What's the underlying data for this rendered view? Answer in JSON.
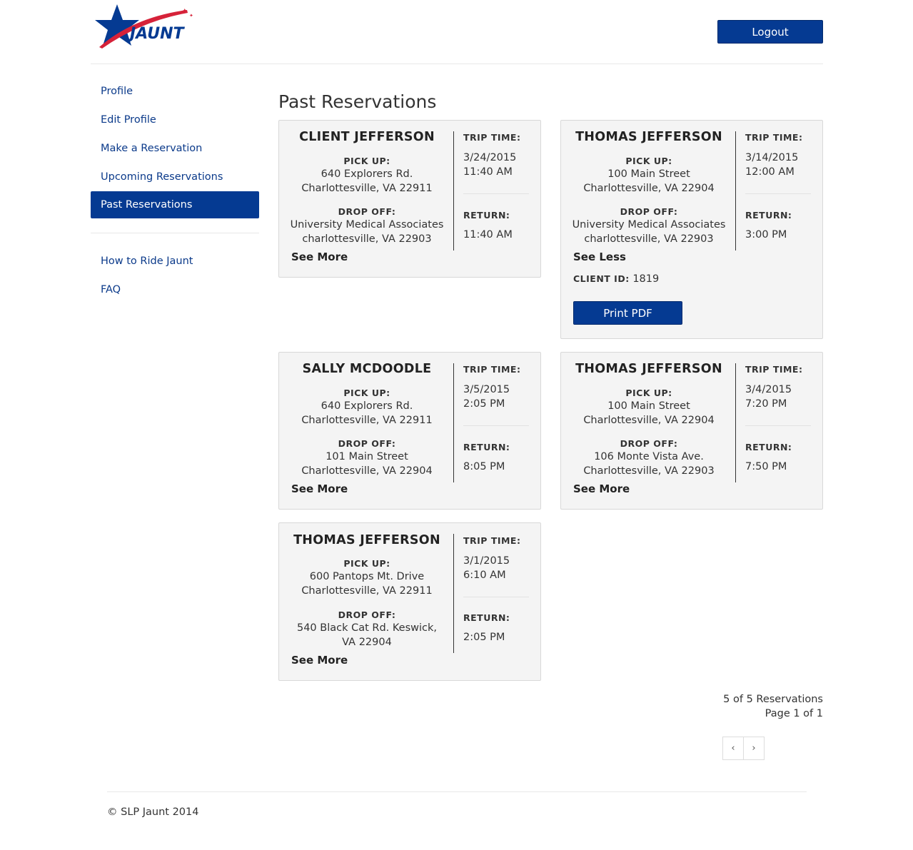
{
  "brand": {
    "logo_text": "JAUNT",
    "primary_color": "#053a92",
    "accent_color": "#d62239"
  },
  "header": {
    "logout_label": "Logout"
  },
  "sidebar": {
    "items": [
      {
        "label": "Profile"
      },
      {
        "label": "Edit Profile"
      },
      {
        "label": "Make a Reservation"
      },
      {
        "label": "Upcoming Reservations"
      },
      {
        "label": "Past Reservations",
        "active": true
      }
    ],
    "secondary": [
      {
        "label": "How to Ride Jaunt"
      },
      {
        "label": "FAQ"
      }
    ]
  },
  "main": {
    "title": "Past Reservations",
    "labels": {
      "trip_time": "TRIP TIME:",
      "pick_up": "PICK UP:",
      "drop_off": "DROP OFF:",
      "return": "RETURN:",
      "see_more": "See More",
      "see_less": "See Less",
      "client_id": "CLIENT ID:",
      "print_pdf": "Print PDF"
    },
    "reservations": [
      {
        "name": "CLIENT JEFFERSON",
        "pickup_line1": "640 Explorers Rd.",
        "pickup_line2": "Charlottesville, VA 22911",
        "dropoff_line1": "University Medical Associates",
        "dropoff_line2": "charlottesville, VA 22903",
        "trip_date": "3/24/2015",
        "trip_time": "11:40 AM",
        "return_time": "11:40 AM",
        "expanded": false
      },
      {
        "name": "THOMAS JEFFERSON",
        "pickup_line1": "100 Main Street",
        "pickup_line2": "Charlottesville, VA 22904",
        "dropoff_line1": "University Medical Associates",
        "dropoff_line2": "charlottesville, VA 22903",
        "trip_date": "3/14/2015",
        "trip_time": "12:00 AM",
        "return_time": "3:00 PM",
        "expanded": true,
        "client_id": "1819"
      },
      {
        "name": "SALLY MCDOODLE",
        "pickup_line1": "640 Explorers Rd.",
        "pickup_line2": "Charlottesville, VA 22911",
        "dropoff_line1": "101 Main Street",
        "dropoff_line2": "Charlottesville, VA 22904",
        "trip_date": "3/5/2015",
        "trip_time": "2:05 PM",
        "return_time": "8:05 PM",
        "expanded": false
      },
      {
        "name": "THOMAS JEFFERSON",
        "pickup_line1": "100 Main Street",
        "pickup_line2": "Charlottesville, VA 22904",
        "dropoff_line1": "106 Monte Vista Ave.",
        "dropoff_line2": "Charlottesville, VA 22903",
        "trip_date": "3/4/2015",
        "trip_time": "7:20 PM",
        "return_time": "7:50 PM",
        "expanded": false
      },
      {
        "name": "THOMAS JEFFERSON",
        "pickup_line1": "600 Pantops Mt. Drive",
        "pickup_line2": "Charlottesville, VA 22911",
        "dropoff_line1": "540 Black Cat Rd. Keswick,",
        "dropoff_line2": "VA 22904",
        "trip_date": "3/1/2015",
        "trip_time": "6:10 AM",
        "return_time": "2:05 PM",
        "expanded": false
      }
    ],
    "pagination": {
      "count_text": "5 of 5 Reservations",
      "page_text": "Page 1 of 1",
      "prev_icon": "‹",
      "next_icon": "›"
    }
  },
  "footer": {
    "text": "© SLP Jaunt 2014"
  }
}
